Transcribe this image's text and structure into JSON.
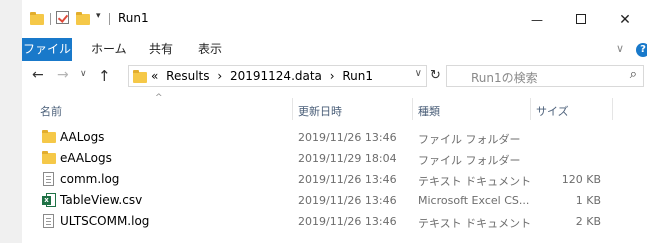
{
  "window": {
    "title": "Run1",
    "quick_access_dropdown": "▾",
    "minimize_glyph": "—",
    "close_glyph": "✕"
  },
  "ribbon": {
    "tabs": [
      "ファイル",
      "ホーム",
      "共有",
      "表示"
    ],
    "expand_glyph": "∨",
    "help_glyph": "?"
  },
  "nav": {
    "back_glyph": "←",
    "forward_glyph": "→",
    "recent_glyph": "∨",
    "up_glyph": "↑",
    "refresh_glyph": "↻"
  },
  "address": {
    "overflow": "«",
    "segments": [
      "Results",
      "20191124.data",
      "Run1"
    ],
    "separator": "›",
    "dropdown_glyph": "∨"
  },
  "search": {
    "placeholder": "Run1の検索",
    "icon_glyph": "⌕"
  },
  "columns": {
    "name": "名前",
    "date": "更新日時",
    "type": "種類",
    "size": "サイズ",
    "sort_glyph": "^"
  },
  "files": [
    {
      "name": "AALogs",
      "date": "2019/11/26 13:46",
      "type": "ファイル フォルダー",
      "size": "",
      "icon": "folder-icon"
    },
    {
      "name": "eAALogs",
      "date": "2019/11/29 18:04",
      "type": "ファイル フォルダー",
      "size": "",
      "icon": "folder-icon"
    },
    {
      "name": "comm.log",
      "date": "2019/11/26 13:46",
      "type": "テキスト ドキュメント",
      "size": "120 KB",
      "icon": "text-document-icon"
    },
    {
      "name": "TableView.csv",
      "date": "2019/11/26 13:46",
      "type": "Microsoft Excel CS...",
      "size": "1 KB",
      "icon": "excel-csv-icon"
    },
    {
      "name": "ULTSCOMM.log",
      "date": "2019/11/26 13:46",
      "type": "テキスト ドキュメント",
      "size": "2 KB",
      "icon": "text-document-icon"
    }
  ],
  "colors": {
    "accent": "#1979ca",
    "folder": "#f5c848",
    "excel": "#1e7145"
  }
}
